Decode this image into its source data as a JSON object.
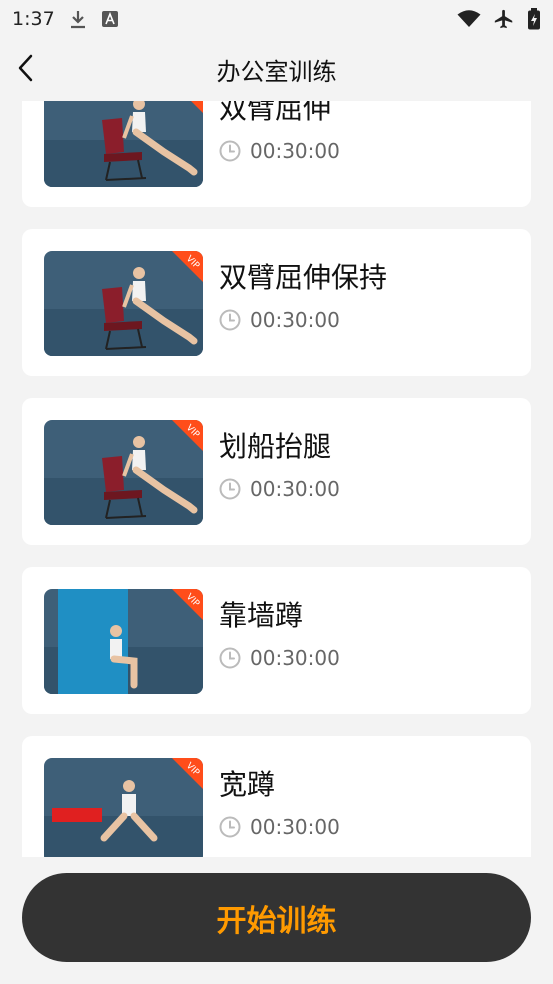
{
  "status_bar": {
    "time": "1:37",
    "left_icons": [
      "download-icon",
      "font-a-icon"
    ],
    "right_icons": [
      "wifi-icon",
      "airplane-icon",
      "battery-icon"
    ]
  },
  "header": {
    "title": "办公室训练"
  },
  "exercises": [
    {
      "title": "双臂屈伸",
      "duration": "00:30:00",
      "badge": "VIP",
      "scene": "chair"
    },
    {
      "title": "双臂屈伸保持",
      "duration": "00:30:00",
      "badge": "VIP",
      "scene": "chair"
    },
    {
      "title": "划船抬腿",
      "duration": "00:30:00",
      "badge": "VIP",
      "scene": "chair"
    },
    {
      "title": "靠墙蹲",
      "duration": "00:30:00",
      "badge": "VIP",
      "scene": "wall"
    },
    {
      "title": "宽蹲",
      "duration": "00:30:00",
      "badge": "VIP",
      "scene": "bench"
    }
  ],
  "start_button": {
    "label": "开始训练"
  },
  "colors": {
    "accent": "#ff9a00",
    "button_bg": "#333333",
    "page_bg": "#f3f3f3",
    "vip_badge": "#ff4d1a",
    "thumb_bg": "#3e5f78"
  }
}
